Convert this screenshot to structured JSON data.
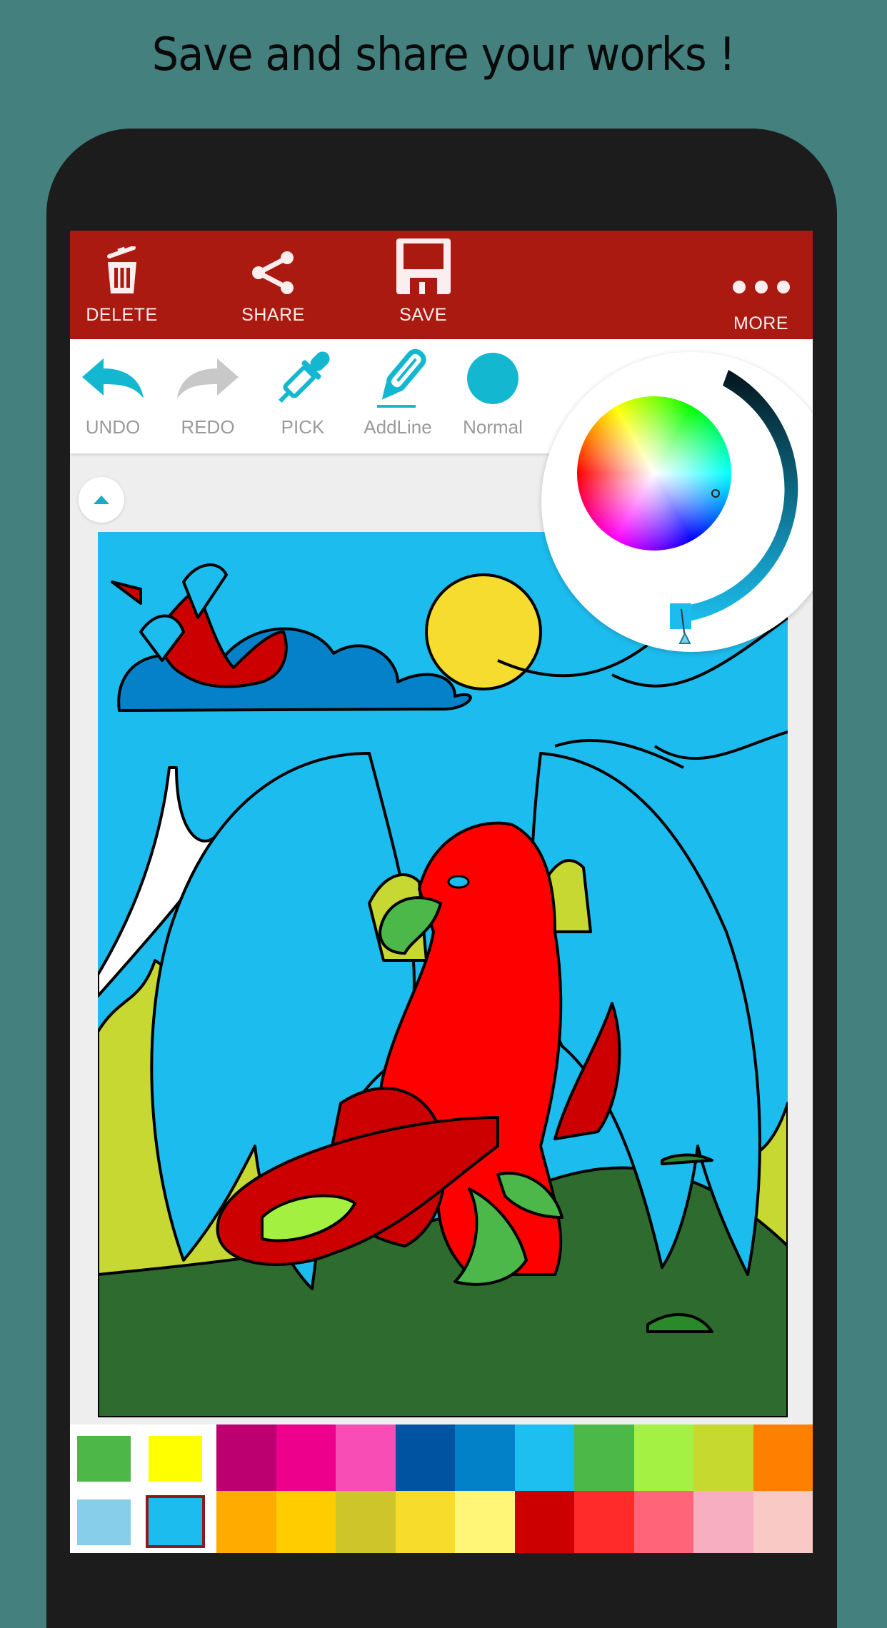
{
  "headline": "Save and share your works !",
  "actionbar": {
    "background": "#ab1a10",
    "actions": [
      {
        "label": "DELETE",
        "icon": "trash-icon"
      },
      {
        "label": "SHARE",
        "icon": "share-icon"
      },
      {
        "label": "SAVE",
        "icon": "floppy-disk-icon"
      },
      {
        "label": "MORE",
        "icon": "more-dots-icon"
      }
    ]
  },
  "toolbar": {
    "accent": "#13b8d0",
    "disabled": "#c8c8c8",
    "tools": [
      {
        "label": "UNDO",
        "icon": "undo-arrow-icon",
        "enabled": true
      },
      {
        "label": "REDO",
        "icon": "redo-arrow-icon",
        "enabled": false
      },
      {
        "label": "PICK",
        "icon": "eyedropper-icon",
        "enabled": true
      },
      {
        "label": "AddLine",
        "icon": "pencil-line-icon",
        "enabled": true
      },
      {
        "label": "Normal",
        "icon": "brush-circle-icon",
        "enabled": true
      }
    ]
  },
  "color_picker": {
    "selected_color": "#1cbdee",
    "wheel": "hue-saturation-wheel",
    "brightness_ring": "dark-to-light-cyan-arc"
  },
  "canvas": {
    "image": "griffin-coloring-page",
    "colors": {
      "sky": "#1cbdee",
      "cloud": "#0581c9",
      "sun": "#f7dc30",
      "bush": "#c8d832",
      "grass": "#2e6b2f",
      "griffin": "#ff0000",
      "griffin_dark": "#cc0000",
      "claws": "#4cb84a",
      "tail_fill": "#a4f040"
    }
  },
  "palette": {
    "recent": [
      "#4db848",
      "#ffff00",
      "#87ceeb",
      "#1cbdee"
    ],
    "selected_recent_index": 3,
    "selected_border": "#8b1a1a",
    "row1": [
      "#bd0070",
      "#ec008c",
      "#f74db5",
      "#0053a1",
      "#0281c8",
      "#1cbff0",
      "#4cb848",
      "#a4f043",
      "#c5d92f",
      "#ff7f00"
    ],
    "row2": [
      "#ffab00",
      "#ffcc00",
      "#cec52b",
      "#f7dc2b",
      "#fff576",
      "#cc0000",
      "#ff2b2b",
      "#ff6479",
      "#f7aec1",
      "#f8c9c5"
    ]
  }
}
